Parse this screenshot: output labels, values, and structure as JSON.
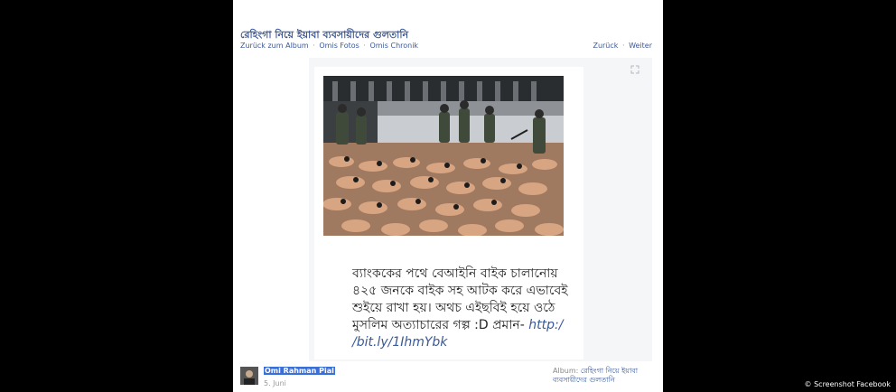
{
  "album_title": "রেহিংগা নিয়ে ইয়াবা ব্যবসায়ীদের গুলতানি",
  "breadcrumb": {
    "back_album": "Zurück zum Album",
    "photos": "Omis Fotos",
    "timeline": "Omis Chronik",
    "separator": "·"
  },
  "pager": {
    "prev": "Zurück",
    "next": "Weiter"
  },
  "expand_icon": "expand-icon",
  "caption": {
    "line1": "ব্যাংককের পথে বেআইনি বাইক চালানোয়",
    "line2": "৪২৫ জনকে বাইক সহ আটক করে এভাবেই",
    "line3": "শুইয়ে রাখা হয়। অথচ এইছবিই হয়ে ওঠে",
    "line4_text": "মুসলিম অত্যাচারের গল্প :D প্রমান-",
    "line4_link": "http:/",
    "line5_link": "/bit.ly/1IhmYbk"
  },
  "post": {
    "author": "Omi Rahman Pial",
    "date": "5. Juni",
    "album_label": "Album:",
    "album_name": "রেহিংগা নিয়ে ইয়াবা ব্যবসায়ীদের গুলতানি"
  },
  "credit": "© Screenshot Facebook",
  "colors": {
    "link": "#3b5998",
    "background": "#000000",
    "selection": "#3b6fd8"
  }
}
